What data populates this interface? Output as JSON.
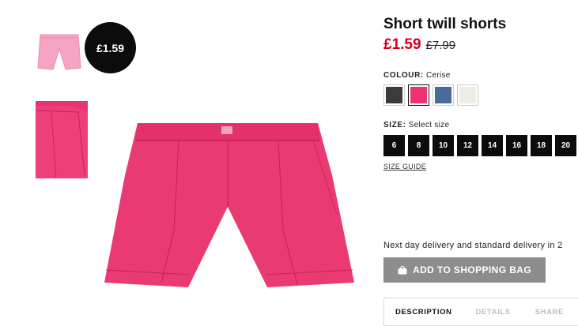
{
  "gallery": {
    "thumbnail_alt_1": "pink shorts thumbnail",
    "thumbnail_alt_2": "shorts detail",
    "price_badge": "£1.59"
  },
  "product": {
    "title": "Short twill shorts",
    "price": "£1.59",
    "old_price": "£7.99"
  },
  "colour": {
    "label": "COLOUR:",
    "selected": "Cerise",
    "swatches": [
      {
        "name": "black",
        "color": "#3b3b3b"
      },
      {
        "name": "cerise",
        "color": "#f0336f"
      },
      {
        "name": "denim-blue",
        "color": "#4b6a9c"
      },
      {
        "name": "off-white",
        "color": "#efece6"
      }
    ]
  },
  "size": {
    "label": "SIZE:",
    "prompt": "Select size",
    "options": [
      "6",
      "8",
      "10",
      "12",
      "14",
      "16",
      "18",
      "20"
    ],
    "guide": "SIZE GUIDE"
  },
  "delivery": "Next day delivery and standard delivery in 2",
  "add_to_bag": {
    "label": "ADD TO SHOPPING BAG",
    "icon": "shopping-bag-icon",
    "color": "#8d8d8d"
  },
  "tabs": {
    "description": "DESCRIPTION",
    "details": "DETAILS",
    "share": "SHARE"
  }
}
